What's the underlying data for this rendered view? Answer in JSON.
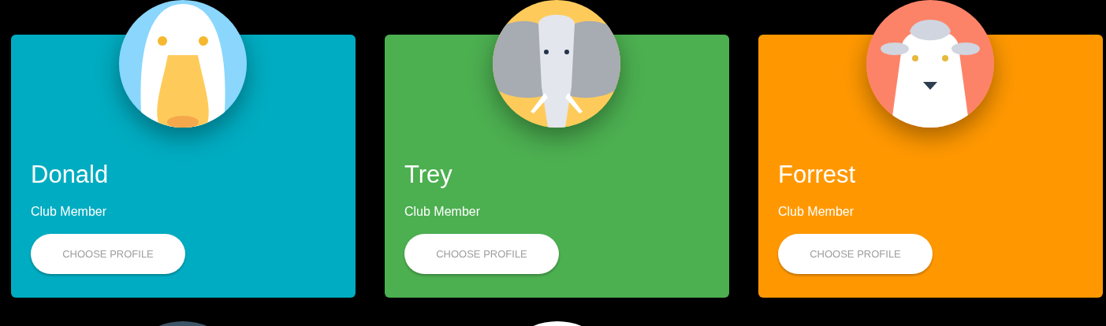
{
  "profiles": [
    {
      "name": "Donald",
      "role": "Club Member",
      "button": "CHOOSE PROFILE",
      "color": "#00acc1"
    },
    {
      "name": "Trey",
      "role": "Club Member",
      "button": "CHOOSE PROFILE",
      "color": "#4caf50"
    },
    {
      "name": "Forrest",
      "role": "Club Member",
      "button": "CHOOSE PROFILE",
      "color": "#ff9800"
    }
  ]
}
